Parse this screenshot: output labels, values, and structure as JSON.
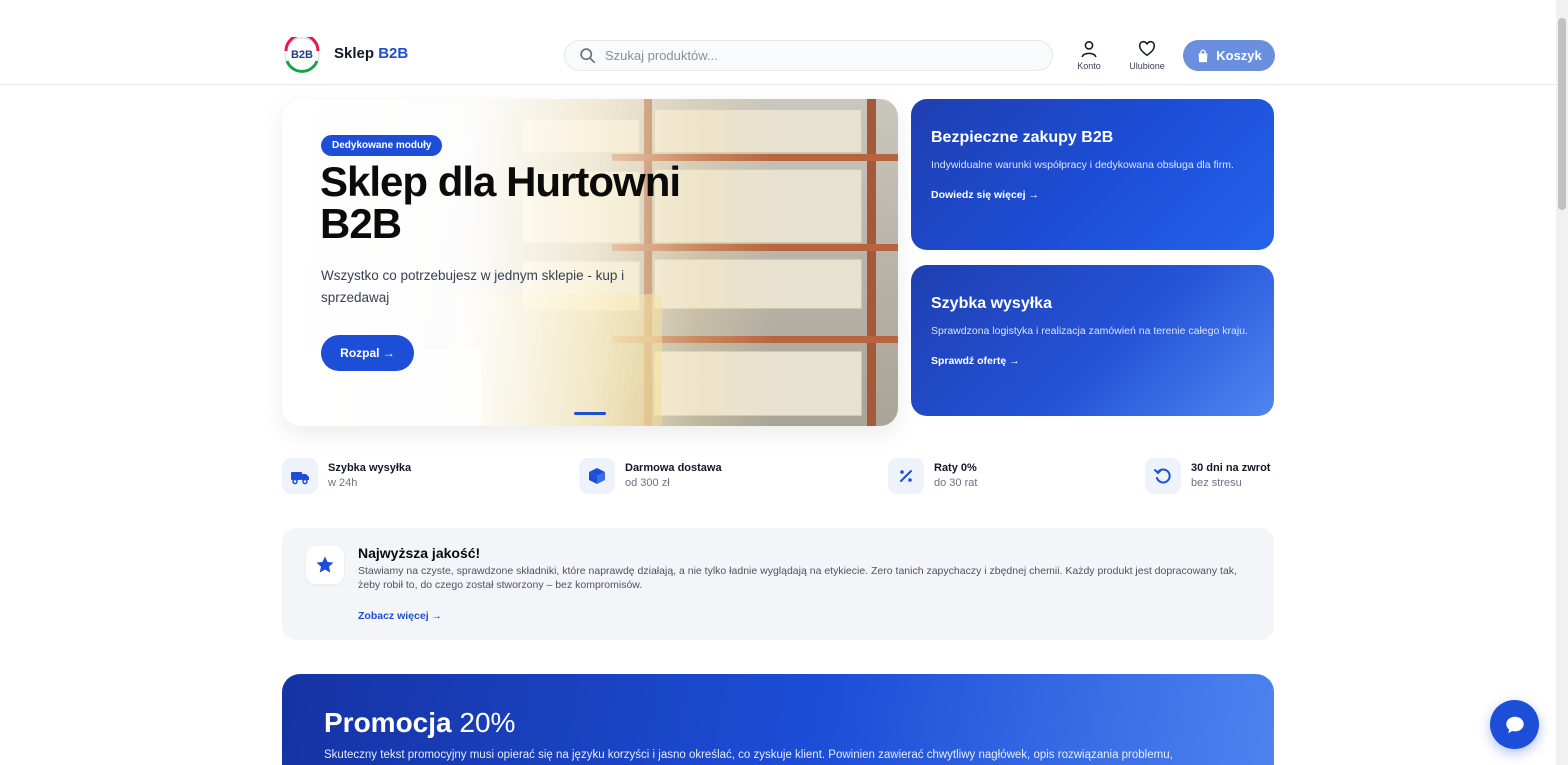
{
  "header": {
    "brand_prefix": "Sklep",
    "brand_suffix": "B2B",
    "search_placeholder": "Szukaj produktów...",
    "account_label": "Konto",
    "favorites_label": "Ulubione",
    "cart_label": "Koszyk"
  },
  "hero": {
    "badge": "Dedykowane moduły",
    "title": "Sklep dla Hurtowni B2B",
    "subtitle": "Wszystko co potrzebujesz w jednym sklepie - kup i sprzedawaj",
    "cta": "Rozpal →"
  },
  "side_cards": [
    {
      "title": "Bezpieczne zakupy B2B",
      "text": "Indywidualne warunki współpracy i dedykowana obsługa dla firm.",
      "link": "Dowiedz się więcej →"
    },
    {
      "title": "Szybka wysyłka",
      "text": "Sprawdzona logistyka i realizacja zamówień na terenie całego kraju.",
      "link": "Sprawdź ofertę →"
    }
  ],
  "features": [
    {
      "title": "Szybka wysyłka",
      "subtitle": "w 24h",
      "icon": "truck-icon"
    },
    {
      "title": "Darmowa dostawa",
      "subtitle": "od 300 zł",
      "icon": "box-icon"
    },
    {
      "title": "Raty 0%",
      "subtitle": "do 30 rat",
      "icon": "percent-icon"
    },
    {
      "title": "30 dni na zwrot",
      "subtitle": "bez stresu",
      "icon": "return-icon"
    }
  ],
  "quality": {
    "title": "Najwyższa jakość!",
    "text": "Stawiamy na czyste, sprawdzone składniki, które naprawdę działają, a nie tylko ładnie wyglądają na etykiecie. Zero tanich zapychaczy i zbędnej chemii. Każdy produkt jest dopracowany tak, żeby robił to, do czego został stworzony – bez kompromisów.",
    "link": "Zobacz więcej →"
  },
  "promo": {
    "title": "Promocja",
    "percent": "20%",
    "text": "Skuteczny tekst promocyjny musi opierać się na języku korzyści i jasno określać, co zyskuje klient. Powinien zawierać chwytliwy nagłówek, opis rozwiązania problemu,"
  },
  "colors": {
    "accent": "#1d4ed8",
    "cart_button": "#6b8fdf"
  }
}
